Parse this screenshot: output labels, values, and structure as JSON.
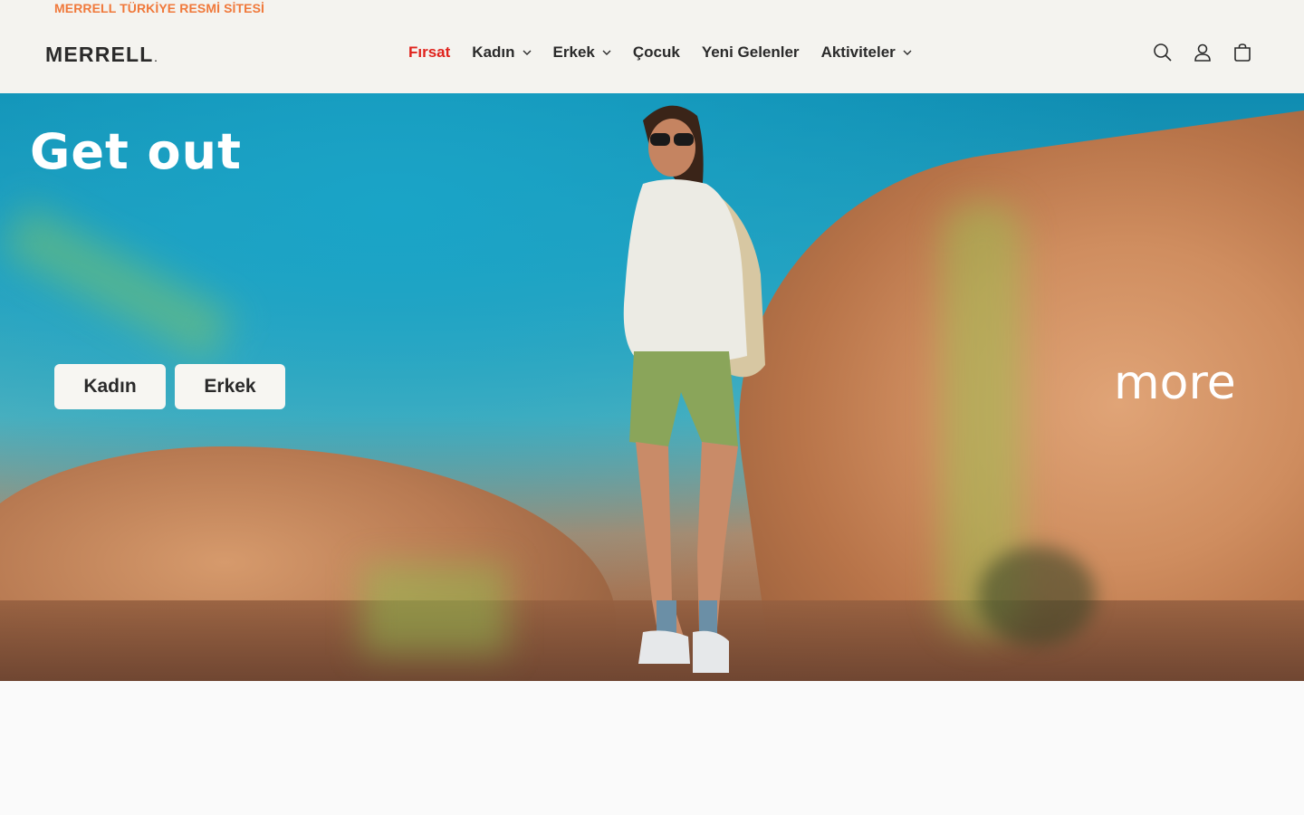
{
  "announcement": {
    "text": "MERRELL TÜRKİYE RESMİ SİTESİ"
  },
  "header": {
    "logo_text": "MERRELL",
    "logo_dot": ".",
    "nav": [
      {
        "label": "Fırsat",
        "has_dropdown": false
      },
      {
        "label": "Kadın",
        "has_dropdown": true
      },
      {
        "label": "Erkek",
        "has_dropdown": true
      },
      {
        "label": "Çocuk",
        "has_dropdown": false
      },
      {
        "label": "Yeni Gelenler",
        "has_dropdown": false
      },
      {
        "label": "Aktiviteler",
        "has_dropdown": true
      }
    ],
    "icons": [
      "search-icon",
      "account-icon",
      "cart-icon"
    ]
  },
  "hero": {
    "title": "Get out",
    "overlay_text": "more",
    "buttons": [
      {
        "label": "Kadın"
      },
      {
        "label": "Erkek"
      }
    ]
  },
  "colors": {
    "announcement_text": "#f0793b",
    "sale_nav": "#e0231d",
    "header_bg": "#f4f3ef",
    "button_bg": "#f7f6f2"
  }
}
